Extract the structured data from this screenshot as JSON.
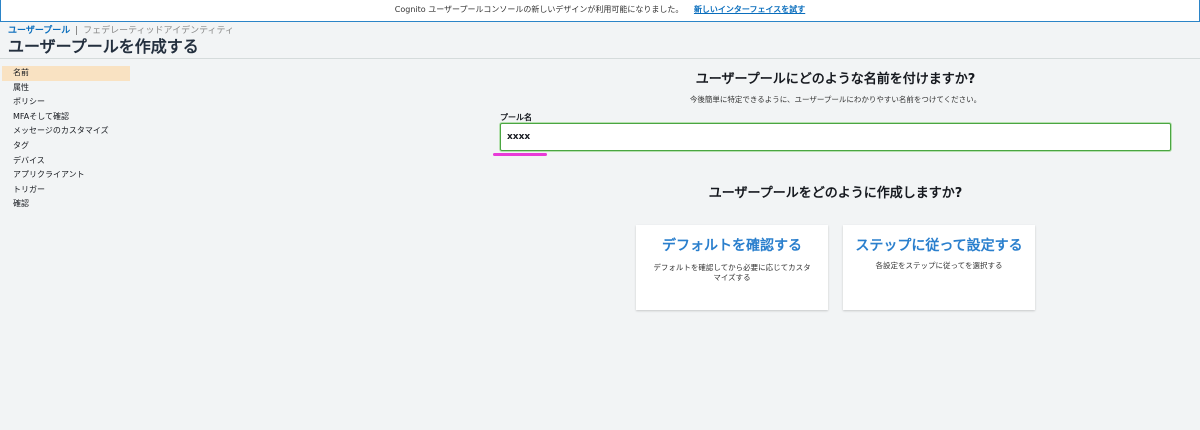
{
  "banner": {
    "text": "Cognito ユーザープールコンソールの新しいデザインが利用可能になりました。",
    "link_label": "新しいインターフェイスを試す"
  },
  "breadcrumb": {
    "active": "ユーザープール",
    "separator": "|",
    "inactive": "フェデレーティッドアイデンティティ"
  },
  "page_title": "ユーザープールを作成する",
  "sidebar": {
    "items": [
      {
        "label": "名前",
        "active": true
      },
      {
        "label": "属性"
      },
      {
        "label": "ポリシー"
      },
      {
        "label": "MFAそして確認"
      },
      {
        "label": "メッセージのカスタマイズ"
      },
      {
        "label": "タグ"
      },
      {
        "label": "デバイス"
      },
      {
        "label": "アプリクライアント"
      },
      {
        "label": "トリガー"
      },
      {
        "label": "確認"
      }
    ]
  },
  "name_section": {
    "heading": "ユーザープールにどのような名前を付けますか?",
    "subtext": "今後簡単に特定できるように、ユーザープールにわかりやすい名前をつけてください。",
    "field_label": "プール名",
    "field_value": "xxxx"
  },
  "create_section": {
    "heading": "ユーザープールをどのように作成しますか?",
    "cards": [
      {
        "title": "デフォルトを確認する",
        "desc": "デフォルトを確認してから必要に応じてカスタマイズする"
      },
      {
        "title": "ステップに従って設定する",
        "desc": "各設定をステップに従ってを選択する"
      }
    ]
  },
  "colors": {
    "accent_link": "#0a6ebd",
    "card_title": "#2a7fcd",
    "input_border": "#4aa541",
    "active_nav": "#f9e2c2",
    "highlight": "#e83ad8"
  }
}
